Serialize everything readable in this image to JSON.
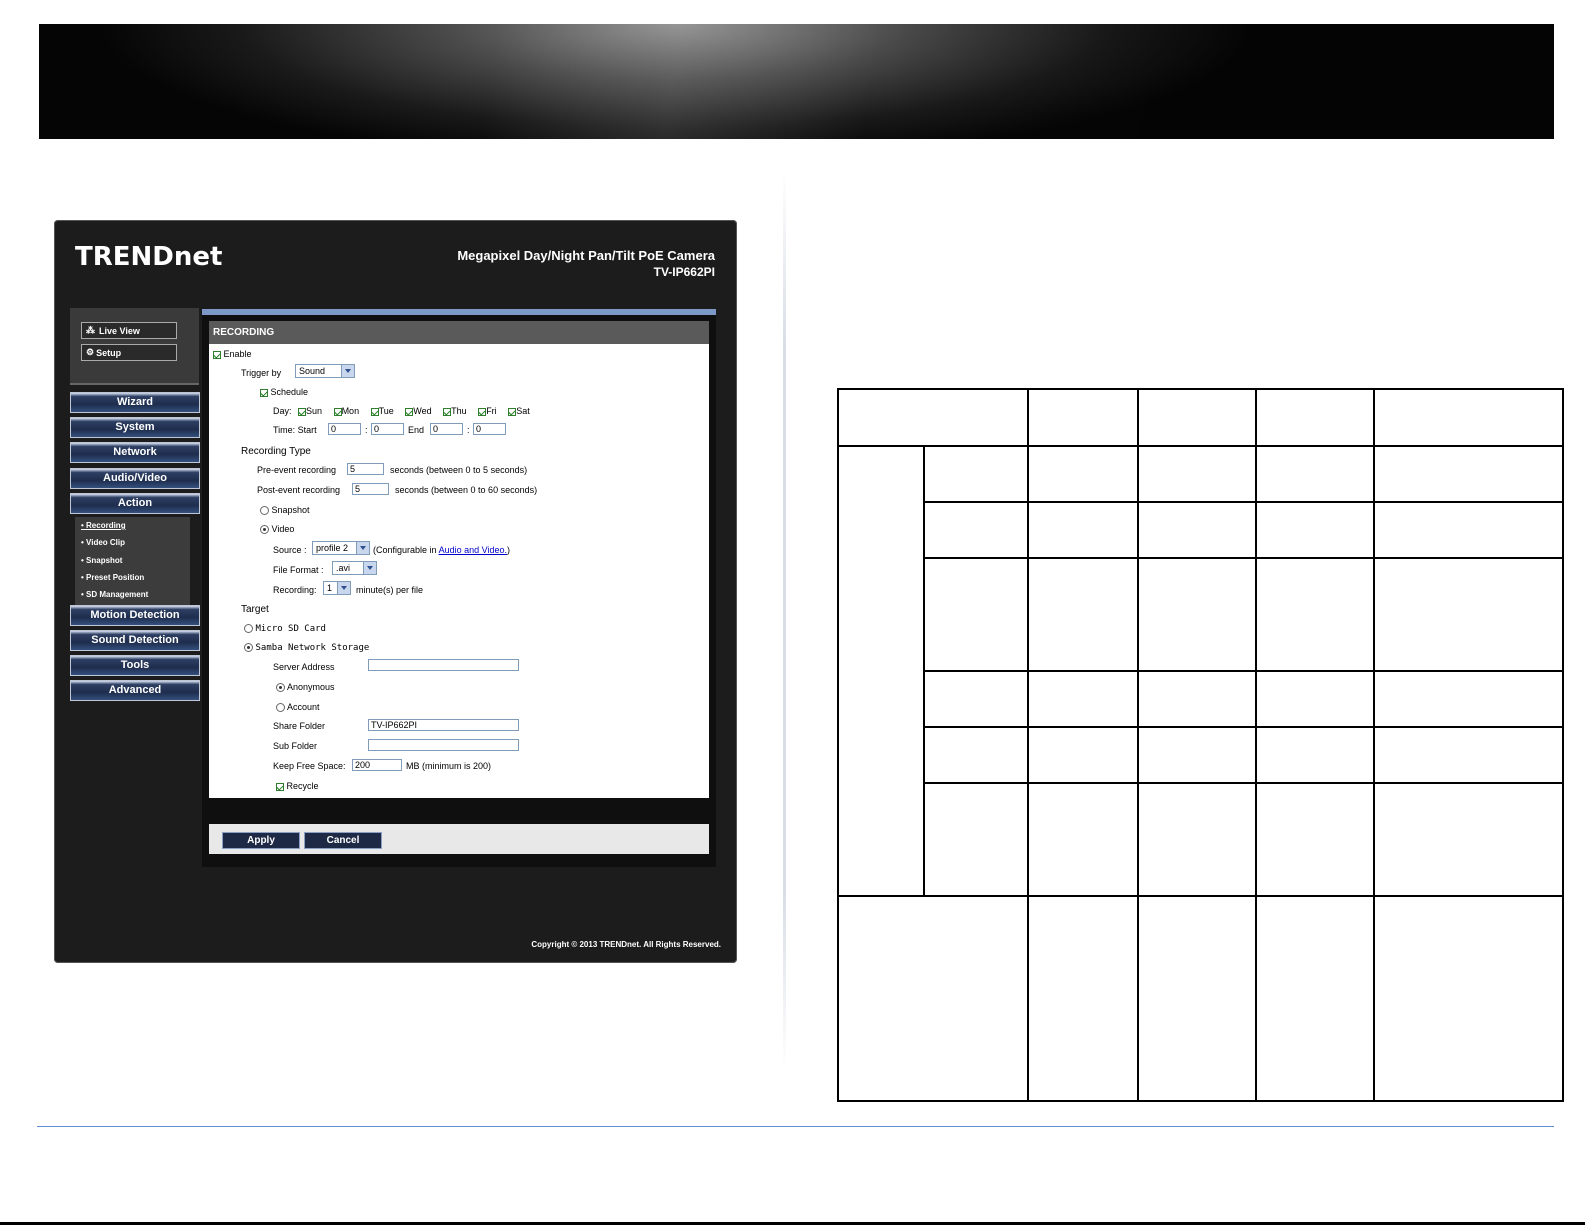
{
  "camera_ui": {
    "brand": "TRENDnet",
    "product_title": "Megapixel Day/Night Pan/Tilt PoE Camera",
    "product_model": "TV-IP662PI",
    "top_buttons": {
      "live_view": "Live View",
      "setup": "Setup"
    },
    "menu": [
      "Wizard",
      "System",
      "Network",
      "Audio/Video",
      "Action"
    ],
    "submenu": [
      "• Recording",
      "• Video Clip",
      "• Snapshot",
      "• Preset Position",
      "• SD Management"
    ],
    "menu_bottom": [
      "Motion Detection",
      "Sound Detection",
      "Tools",
      "Advanced"
    ],
    "panel_title": "RECORDING",
    "form": {
      "enable": "Enable",
      "trigger_by": "Trigger by",
      "trigger_value": "Sound",
      "schedule": "Schedule",
      "day_label": "Day:",
      "days": [
        "Sun",
        "Mon",
        "Tue",
        "Wed",
        "Thu",
        "Fri",
        "Sat"
      ],
      "time_label": "Time: Start",
      "end_label": "End",
      "colon": ":",
      "start_h": "0",
      "start_m": "0",
      "end_h": "0",
      "end_m": "0",
      "recording_type": "Recording Type",
      "pre_event": "Pre-event recording",
      "pre_value": "5",
      "pre_hint": "seconds (between 0 to 5 seconds)",
      "post_event": "Post-event recording",
      "post_value": "5",
      "post_hint": "seconds (between 0 to 60 seconds)",
      "snapshot": "Snapshot",
      "video": "Video",
      "source_label": "Source :",
      "source_value": "profile 2",
      "configurable_prefix": "(Configurable in",
      "configurable_link": "Audio and Video.",
      "configurable_suffix": ")",
      "file_format_label": "File Format :",
      "file_format_value": ".avi",
      "recording_label": "Recording:",
      "recording_value": "1",
      "recording_suffix": "minute(s) per file",
      "target": "Target",
      "micro_sd": "Micro SD Card",
      "samba": "Samba Network Storage",
      "server_address": "Server Address",
      "server_value": "",
      "anonymous": "Anonymous",
      "account": "Account",
      "share_folder": "Share Folder",
      "share_value": "TV-IP662PI",
      "sub_folder": "Sub Folder",
      "sub_value": "",
      "keep_free": "Keep Free Space:",
      "keep_value": "200",
      "keep_hint": "MB (minimum is 200)",
      "recycle": "Recycle"
    },
    "apply": "Apply",
    "cancel": "Cancel",
    "copyright": "Copyright © 2013 TRENDnet. All Rights Reserved."
  },
  "colors": {
    "menu_blue": "#2d3f63",
    "panel_accent": "#7c99c8",
    "link": "#0000cc"
  }
}
